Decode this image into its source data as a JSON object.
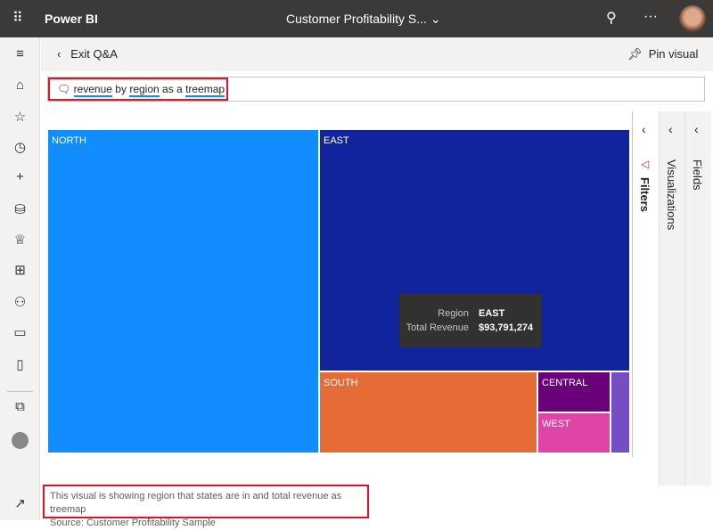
{
  "topbar": {
    "app_title": "Power BI",
    "report_title": "Customer Profitability S...",
    "icons": [
      "app-launcher-icon",
      "chevron-down-icon",
      "search-icon",
      "more-icon",
      "avatar"
    ]
  },
  "header": {
    "exit_label": "Exit Q&A",
    "pin_label": "Pin visual"
  },
  "qa": {
    "words": [
      "revenue",
      "by",
      "region",
      "as a",
      "treemap"
    ]
  },
  "sidebar": {
    "icons": [
      "hamburger-icon",
      "home-icon",
      "star-icon",
      "recent-icon",
      "plus-icon",
      "datasets-icon",
      "goals-icon",
      "apps-icon",
      "shared-icon",
      "learn-icon",
      "book-icon",
      "workspaces-icon",
      "workspace-avatar-icon",
      "expand-icon"
    ]
  },
  "chart_data": {
    "type": "treemap",
    "categories": [
      "NORTH",
      "EAST",
      "SOUTH",
      "CENTRAL",
      "WEST",
      ""
    ],
    "colors": [
      "#118dff",
      "#12239e",
      "#e66c37",
      "#6b007b",
      "#e044a7",
      "#744ec2"
    ],
    "tooltip": {
      "region_label": "Region",
      "region_value": "EAST",
      "revenue_label": "Total Revenue",
      "revenue_value": "$93,791,274"
    }
  },
  "panes": {
    "filters": "Filters",
    "visualizations": "Visualizations",
    "fields": "Fields"
  },
  "footer": {
    "line1": "This visual is showing region that states are in and total revenue as treemap",
    "line2": "Source: Customer Profitability Sample"
  }
}
